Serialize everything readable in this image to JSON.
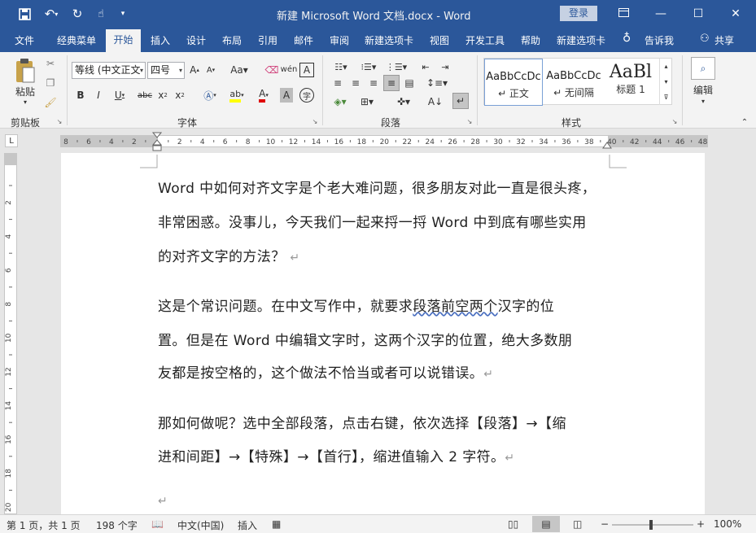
{
  "titlebar": {
    "title": "新建 Microsoft Word 文档.docx  -  Word",
    "login": "登录",
    "qat_icons": [
      "save-icon",
      "undo-icon",
      "redo-icon",
      "touch-mode-icon",
      "customize-qat-icon"
    ]
  },
  "tabs": [
    "文件",
    "经典菜单",
    "开始",
    "插入",
    "设计",
    "布局",
    "引用",
    "邮件",
    "审阅",
    "新建选项卡",
    "视图",
    "开发工具",
    "帮助",
    "新建选项卡"
  ],
  "tell_me": "告诉我",
  "share": "共享",
  "ribbon": {
    "clipboard": {
      "paste": "粘贴",
      "label": "剪贴板"
    },
    "font": {
      "font_name": "等线 (中文正文",
      "font_size": "四号",
      "label": "字体"
    },
    "paragraph": {
      "label": "段落"
    },
    "styles": {
      "label": "样式",
      "items": [
        {
          "preview": "AaBbCcDc",
          "name": "↵ 正文"
        },
        {
          "preview": "AaBbCcDc",
          "name": "↵ 无间隔"
        },
        {
          "preview": "AaBl",
          "name": "标题 1"
        }
      ]
    },
    "editing": {
      "label": "编辑"
    }
  },
  "ruler": {
    "h_ticks": [
      "8",
      "6",
      "4",
      "2",
      "",
      "2",
      "4",
      "6",
      "8",
      "10",
      "12",
      "14",
      "16",
      "18",
      "20",
      "22",
      "24",
      "26",
      "28",
      "30",
      "32",
      "34",
      "36",
      "38",
      "40",
      "42",
      "44",
      "46",
      "48"
    ],
    "v_ticks": [
      "2",
      "4",
      "6",
      "8",
      "10",
      "12",
      "14",
      "16",
      "18",
      "20"
    ]
  },
  "document": {
    "lines": [
      "Word 中如何对齐文字是个老大难问题，很多朋友对此一直是很头疼，",
      "非常困惑。没事儿，今天我们一起来捋一捋 Word 中到底有哪些实用",
      "的对齐文字的方法？",
      "这是个常识问题。在中文写作中，就要求段落前空两个汉字的位",
      "置。但是在 Word 中编辑文字时，这两个汉字的位置，绝大多数朋",
      "友都是按空格的，这个做法不恰当或者可以说错误。",
      "那如何做呢？选中全部段落，点击右键，依次选择【段落】→【缩",
      "进和间距】→【特殊】→【首行】，缩进值输入 2 字符。"
    ],
    "para_mark": "↵"
  },
  "statusbar": {
    "page": "第 1 页，共 1 页",
    "words": "198 个字",
    "language": "中文(中国)",
    "mode": "插入",
    "zoom": "100%",
    "zoom_level": 1.0
  },
  "colors": {
    "accent": "#2b579a",
    "ribbon_bg": "#f3f3f3"
  }
}
